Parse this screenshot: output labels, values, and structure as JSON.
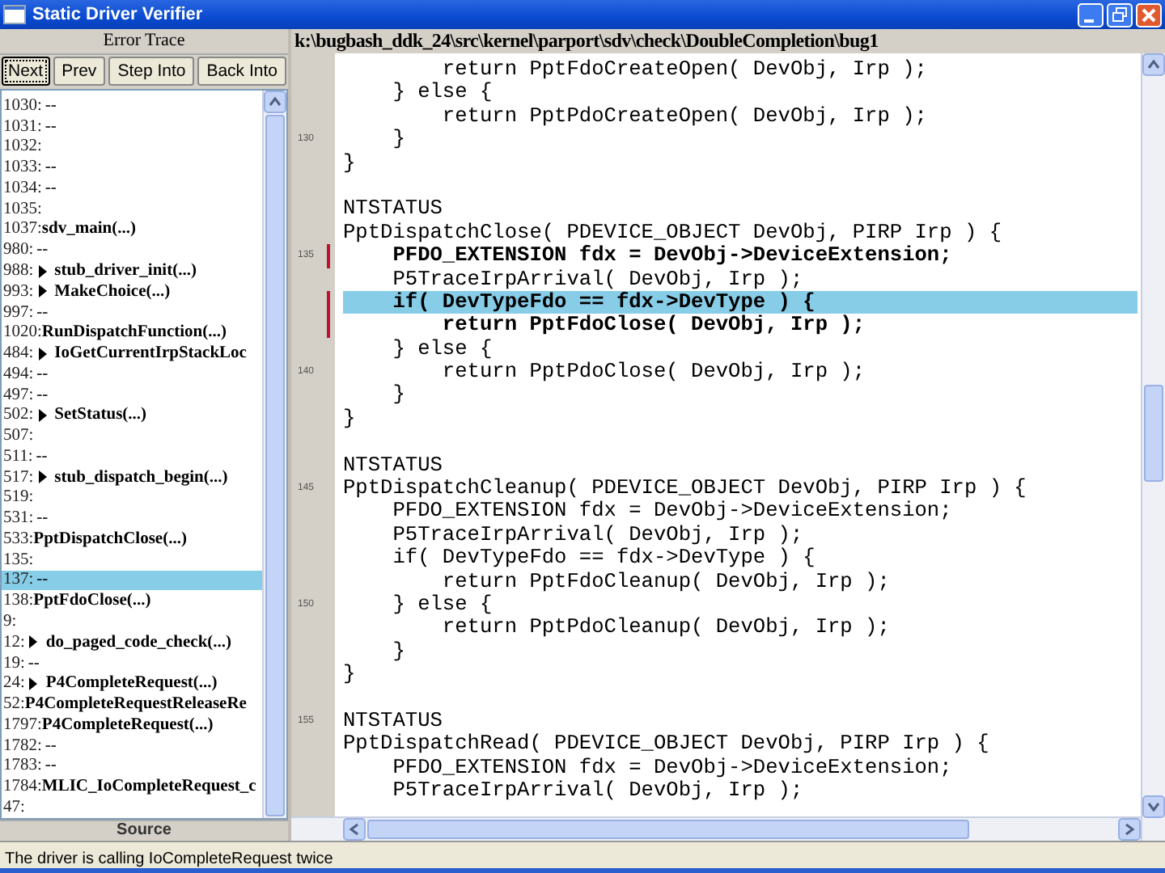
{
  "window": {
    "title": "Static Driver Verifier"
  },
  "trace": {
    "title": "Error Trace",
    "buttons": [
      {
        "label": "Next",
        "focused": true
      },
      {
        "label": "Prev",
        "focused": false
      },
      {
        "label": "Step Into",
        "focused": false
      },
      {
        "label": "Back Into",
        "focused": false
      }
    ],
    "rows": [
      {
        "number": "1030:",
        "text": "--",
        "selected": false
      },
      {
        "number": "1031:",
        "text": "--",
        "selected": false
      },
      {
        "number": "1032:",
        "selected": false
      },
      {
        "number": "1033:",
        "text": "--",
        "selected": false
      },
      {
        "number": "1034:",
        "text": "--",
        "selected": false
      },
      {
        "number": "1035:",
        "selected": false
      },
      {
        "number": "1037:",
        "function": "sdv_main(...)",
        "expandable": false,
        "selected": false
      },
      {
        "number": "980:",
        "text": "--",
        "selected": false
      },
      {
        "number": "988:",
        "function": "stub_driver_init(...)",
        "expandable": true,
        "selected": false
      },
      {
        "number": "993:",
        "function": "MakeChoice(...)",
        "expandable": true,
        "selected": false
      },
      {
        "number": "997:",
        "text": "--",
        "selected": false
      },
      {
        "number": "1020:",
        "function": "RunDispatchFunction(...)",
        "expandable": false,
        "selected": false
      },
      {
        "number": "484:",
        "function": "IoGetCurrentIrpStackLoc",
        "expandable": true,
        "selected": false
      },
      {
        "number": "494:",
        "text": "--",
        "selected": false
      },
      {
        "number": "497:",
        "text": "--",
        "selected": false
      },
      {
        "number": "502:",
        "function": "SetStatus(...)",
        "expandable": true,
        "selected": false
      },
      {
        "number": "507:",
        "selected": false
      },
      {
        "number": "511:",
        "text": "--",
        "selected": false
      },
      {
        "number": "517:",
        "function": "stub_dispatch_begin(...)",
        "expandable": true,
        "selected": false
      },
      {
        "number": "519:",
        "selected": false
      },
      {
        "number": "531:",
        "text": "--",
        "selected": false
      },
      {
        "number": "533:",
        "function": "PptDispatchClose(...)",
        "expandable": false,
        "selected": false
      },
      {
        "number": "135:",
        "selected": false
      },
      {
        "number": "137:",
        "text": "--",
        "selected": true
      },
      {
        "number": "138:",
        "function": "PptFdoClose(...)",
        "expandable": false,
        "selected": false
      },
      {
        "number": "9:",
        "selected": false
      },
      {
        "number": "12:",
        "function": "do_paged_code_check(...)",
        "expandable": true,
        "selected": false
      },
      {
        "number": "19:",
        "text": "--",
        "selected": false
      },
      {
        "number": "24:",
        "function": "P4CompleteRequest(...)",
        "expandable": true,
        "selected": false
      },
      {
        "number": "52:",
        "function": "P4CompleteRequestReleaseRe",
        "expandable": false,
        "selected": false
      },
      {
        "number": "1797:",
        "function": "P4CompleteRequest(...)",
        "expandable": false,
        "selected": false
      },
      {
        "number": "1782:",
        "text": "--",
        "selected": false
      },
      {
        "number": "1783:",
        "text": "--",
        "selected": false
      },
      {
        "number": "1784:",
        "function": "MLIC_IoCompleteRequest_c",
        "expandable": false,
        "selected": false
      },
      {
        "number": "47:",
        "selected": false
      }
    ],
    "footer": "Source"
  },
  "code": {
    "path": "k:\\bugbash_ddk_24\\src\\kernel\\parport\\sdv\\check\\DoubleCompletion\\bug1",
    "lines": [
      {
        "kind": "code",
        "text": "        return PptFdoCreateOpen( DevObj, Irp );",
        "bold": false,
        "highlighted": false
      },
      {
        "kind": "code",
        "text": "    } else {",
        "bold": false,
        "highlighted": false
      },
      {
        "kind": "code",
        "text": "        return PptPdoCreateOpen( DevObj, Irp );",
        "bold": false,
        "highlighted": false
      },
      {
        "kind": "code",
        "gutter": "130",
        "text": "    }",
        "bold": false,
        "highlighted": false
      },
      {
        "kind": "code",
        "text": "}",
        "bold": false,
        "highlighted": false
      },
      {
        "kind": "blank"
      },
      {
        "kind": "code",
        "text": "NTSTATUS",
        "bold": false,
        "highlighted": false
      },
      {
        "kind": "code",
        "text": "PptDispatchClose( PDEVICE_OBJECT DevObj, PIRP Irp ) {",
        "bold": false,
        "highlighted": false
      },
      {
        "kind": "code",
        "gutter": "135",
        "text": "    PFDO_EXTENSION fdx = DevObj->DeviceExtension;",
        "bold": true,
        "highlighted": false,
        "marker": true
      },
      {
        "kind": "code",
        "text": "    P5TraceIrpArrival( DevObj, Irp );",
        "bold": false,
        "highlighted": false
      },
      {
        "kind": "code",
        "text": "    if( DevTypeFdo == fdx->DevType ) {",
        "bold": true,
        "highlighted": true,
        "marker": true
      },
      {
        "kind": "code",
        "text": "        return PptFdoClose( DevObj, Irp );",
        "bold": true,
        "highlighted": false,
        "marker": true
      },
      {
        "kind": "code",
        "text": "    } else {",
        "bold": false,
        "highlighted": false
      },
      {
        "kind": "code",
        "gutter": "140",
        "text": "        return PptPdoClose( DevObj, Irp );",
        "bold": false,
        "highlighted": false
      },
      {
        "kind": "code",
        "text": "    }",
        "bold": false,
        "highlighted": false
      },
      {
        "kind": "code",
        "text": "}",
        "bold": false,
        "highlighted": false
      },
      {
        "kind": "blank"
      },
      {
        "kind": "code",
        "text": "NTSTATUS",
        "bold": false,
        "highlighted": false
      },
      {
        "kind": "code",
        "gutter": "145",
        "text": "PptDispatchCleanup( PDEVICE_OBJECT DevObj, PIRP Irp ) {",
        "bold": false,
        "highlighted": false
      },
      {
        "kind": "code",
        "text": "    PFDO_EXTENSION fdx = DevObj->DeviceExtension;",
        "bold": false,
        "highlighted": false
      },
      {
        "kind": "code",
        "text": "    P5TraceIrpArrival( DevObj, Irp );",
        "bold": false,
        "highlighted": false
      },
      {
        "kind": "code",
        "text": "    if( DevTypeFdo == fdx->DevType ) {",
        "bold": false,
        "highlighted": false
      },
      {
        "kind": "code",
        "text": "        return PptFdoCleanup( DevObj, Irp );",
        "bold": false,
        "highlighted": false
      },
      {
        "kind": "code",
        "gutter": "150",
        "text": "    } else {",
        "bold": false,
        "highlighted": false
      },
      {
        "kind": "code",
        "text": "        return PptPdoCleanup( DevObj, Irp );",
        "bold": false,
        "highlighted": false
      },
      {
        "kind": "code",
        "text": "    }",
        "bold": false,
        "highlighted": false
      },
      {
        "kind": "code",
        "text": "}",
        "bold": false,
        "highlighted": false
      },
      {
        "kind": "blank"
      },
      {
        "kind": "code",
        "gutter": "155",
        "text": "NTSTATUS",
        "bold": false,
        "highlighted": false
      },
      {
        "kind": "code",
        "text": "PptDispatchRead( PDEVICE_OBJECT DevObj, PIRP Irp ) {",
        "bold": false,
        "highlighted": false
      },
      {
        "kind": "code",
        "text": "    PFDO_EXTENSION fdx = DevObj->DeviceExtension;",
        "bold": false,
        "highlighted": false
      },
      {
        "kind": "code",
        "text": "    P5TraceIrpArrival( DevObj, Irp );",
        "bold": false,
        "highlighted": false
      }
    ]
  },
  "status_bar": "The driver is calling IoCompleteRequest twice"
}
